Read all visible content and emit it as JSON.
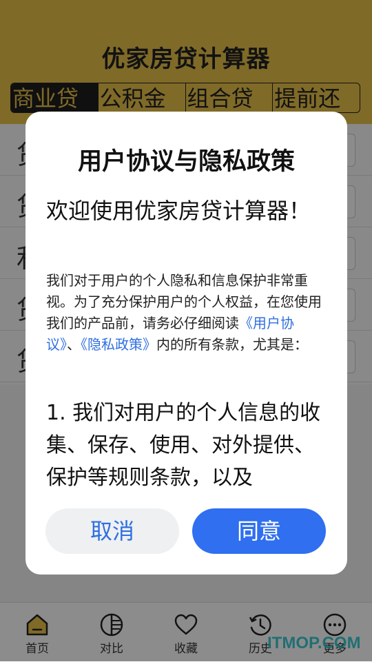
{
  "app": {
    "title": "优家房贷计算器",
    "tabs": [
      "商业贷",
      "公积金",
      "组合贷",
      "提前还"
    ],
    "form_row_labels": [
      "贷",
      "贷",
      "利",
      "贷",
      "贷"
    ]
  },
  "bottom_nav": [
    {
      "label": "首页",
      "icon": "home-icon"
    },
    {
      "label": "对比",
      "icon": "compare-icon"
    },
    {
      "label": "收藏",
      "icon": "heart-icon"
    },
    {
      "label": "历史",
      "icon": "history-icon"
    },
    {
      "label": "更多",
      "icon": "more-icon"
    }
  ],
  "watermark": "ITMOP.COM",
  "dialog": {
    "title": "用户协议与隐私政策",
    "welcome": "欢迎使用优家房贷计算器！",
    "intro_part1": "我们对于用户的个人隐私和信息保护非常重视。为了充分保护用户的个人权益，在您使用我们的产品前，请务必仔细阅读",
    "link_agreement": "《用户协议》",
    "separator": "、",
    "link_privacy": "《隐私政策》",
    "intro_part2": "内的所有条款，尤其是：",
    "term1": "1. 我们对用户的个人信息的收集、保存、使用、对外提供、保护等规则条款，以及",
    "cancel_label": "取消",
    "agree_label": "同意"
  },
  "colors": {
    "header_bg": "#e8c24a",
    "accent_blue": "#2f6ff0",
    "link_blue": "#2f6fe0"
  }
}
